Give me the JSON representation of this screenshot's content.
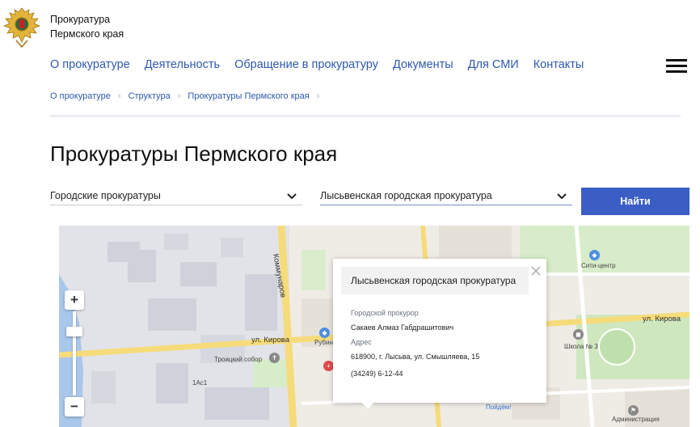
{
  "header": {
    "org_line1": "Прокуратура",
    "org_line2": "Пермского края",
    "logo_icon": "double-headed-eagle-emblem"
  },
  "nav": {
    "items": [
      "О прокуратуре",
      "Деятельность",
      "Обращение в прокуратуру",
      "Документы",
      "Для СМИ",
      "Контакты"
    ],
    "menu_icon": "hamburger-icon"
  },
  "breadcrumb": [
    "О прокуратуре",
    "Структура",
    "Прокуратуры Пермского края"
  ],
  "page_title": "Прокуратуры Пермского края",
  "filters": {
    "type_select": "Городские прокуратуры",
    "office_select": "Лысьвенская городская прокуратура",
    "find_button": "Найти"
  },
  "map": {
    "zoom_in": "+",
    "zoom_out": "−",
    "labels": {
      "street_kommunarov": "Коммунаров",
      "street_kirova_left": "ул. Кирова",
      "street_kirova_right": "ул. Кирова",
      "trinity_cathedral": "Троицкий собор",
      "city_center": "Сити-центр",
      "school": "Школа № 3",
      "administration": "Администрация",
      "rubin": "Рубин",
      "house_1ac1": "1Ас1",
      "find_badge": "Пойдём!"
    },
    "popup": {
      "title": "Лысьвенская городская прокуратура",
      "role_label": "Городской прокурор",
      "role_value": "Сакаев Алмаз Габдрашитович",
      "address_label": "Адрес",
      "address_value": "618900, г. Лысьва, ул. Смышляева, 15",
      "phone": "(34249) 6-12-44"
    }
  },
  "colors": {
    "accent": "#3a5ec4",
    "link": "#3058b0"
  }
}
